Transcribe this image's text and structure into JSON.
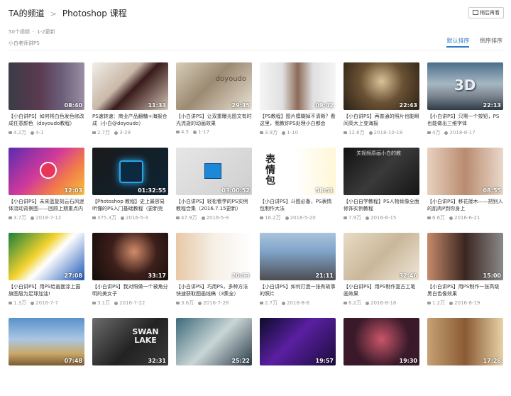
{
  "header": {
    "channel": "TA的频道",
    "sep": ">",
    "current": "Photoshop 课程",
    "later_label": "稍后再看"
  },
  "meta": {
    "count": "50个视频",
    "updated": "1-2更新",
    "dot": "·",
    "author": "小白老师讲PS"
  },
  "sort": {
    "default_label": "默认排序",
    "reverse_label": "倒序排序"
  },
  "videos": [
    {
      "title": "【小白讲PS】如何将白色发色修改成任意颜色（doyoudo教程）",
      "views": "4.2万",
      "date": "4-1",
      "duration": "08:40",
      "bg": "linear-gradient(90deg,#3b3b47,#5a3a4e 40%,#6b5e7a 70%,#9a8fa4)"
    },
    {
      "title": "PS速转速：商业产品翻糖+海报合成（小白@doyoudo）",
      "views": "2.7万",
      "date": "3-29",
      "duration": "11:33",
      "bg": "linear-gradient(135deg,#f1eee9,#c9b9a8 40%,#3a1b1b 55%,#d4c6b6)"
    },
    {
      "title": "【小白讲PS】让双重曝光图文有时光流逝的动画效果",
      "views": "4.5",
      "date": "1-17",
      "duration": "29:35",
      "bg": "linear-gradient(135deg,#d8cdb8,#9c8a72 45%,#e9e2d4)"
    },
    {
      "title": "【PS教程】图片模糊掉不清晰？看这里，我教你PS处理小白都会",
      "views": "3.9万",
      "date": "1-10",
      "duration": "09:42",
      "bg": "linear-gradient(90deg,#f5f5f5,#e0e0e0 30%,#8c6a58 50%,#e0e0e0 70%,#f5f5f5)"
    },
    {
      "title": "【小白讲PS】再普通的照片也能瞬间高大上变海报",
      "views": "12.6万",
      "date": "2018-10-18",
      "duration": "22:43",
      "bg": "radial-gradient(circle at 50% 40%,#d9c39a,#6b5234 45%,#2a2016)"
    },
    {
      "title": "【小白讲PS】只需一个按钮，PS也能做出三维字体",
      "views": "4万",
      "date": "2018-8-17",
      "duration": "22:13",
      "bg": "linear-gradient(180deg,#4b6f8a,#a6b7c3 45%,#7d8791 70%,#2f3c48)"
    },
    {
      "title": "【小白讲PS】未来蓝复刻云石风迷体流动背景图——回顾上期重点内容篇",
      "views": "3.7万",
      "date": "2018-7-12",
      "duration": "12:03",
      "bg": "linear-gradient(135deg,#5b2bb0,#d23a9a 45%,#f07a4a 70%,#f9c23d)"
    },
    {
      "title": "【Photoshop 教程】史上最容易听懂的PS入门基础教程（更新完毕）",
      "views": "375.3万",
      "date": "2016-5-3",
      "duration": "01:32:55",
      "bg": "linear-gradient(135deg,#1a1a1a,#0d2434)"
    },
    {
      "title": "【小白讲PS】轻松看学的PS实例教程合集（2016.7.15更新）",
      "views": "47.9万",
      "date": "2016-5-9",
      "duration": "03:00:52",
      "bg": "linear-gradient(135deg,#e6e6e6,#cfcfcf)"
    },
    {
      "title": "【小白讲PS】斗图必备，PS表情包制作大法",
      "views": "16.2万",
      "date": "2016-5-20",
      "duration": "58:51",
      "bg": "linear-gradient(90deg,#ffffff,#ffffff 45%,#fff7d6 100%)"
    },
    {
      "title": "【小白自学教程】PS人物肖像全面修饰实例教程",
      "views": "7.9万",
      "date": "2016-6-15",
      "duration": "",
      "bg": "linear-gradient(135deg,#111,#3a3a3a 50%,#151515)"
    },
    {
      "title": "【小白讲PS】移花接木——把别人的肌肉P到你身上",
      "views": "6.6万",
      "date": "2016-6-21",
      "duration": "08:55",
      "bg": "linear-gradient(90deg,#e7d2c0,#b98b6f 50%,#e9d9cb)"
    },
    {
      "title": "【小白讲PS】用PS给画面涂上国旗图层为足球加油!",
      "views": "1.3万",
      "date": "2016-7-7",
      "duration": "27:08",
      "bg": "linear-gradient(135deg,#1a7f3c,#f2d22e 40%,#ffffff 55%,#1a56b4)"
    },
    {
      "title": "【小白讲PS】我对照做一个被角分明的美女子",
      "views": "3.1万",
      "date": "2016-7-22",
      "duration": "33:17",
      "bg": "radial-gradient(circle at 55% 40%,#d28c6a,#3c1f1a 45%,#120c0a)"
    },
    {
      "title": "【小白讲PS】巧用PS，多种方法快速获取图画线稿（3集全）",
      "views": "3.6万",
      "date": "2016-7-28",
      "duration": "20:53",
      "bg": "linear-gradient(90deg,#e7c8a6,#f5efe6 50%,#ffffff)"
    },
    {
      "title": "【小白讲PS】如何打造一张有故事的照片",
      "views": "2.7万",
      "date": "2016-8-8",
      "duration": "21:11",
      "bg": "linear-gradient(180deg,#a9c4de,#7fa3c7 40%,#4d4d52)"
    },
    {
      "title": "【小白讲PS】用PS制作复古工笔画效果",
      "views": "6.2万",
      "date": "2016-8-18",
      "duration": "32:46",
      "bg": "linear-gradient(135deg,#e8dcc5,#c9b79a 50%,#f0e7d6)"
    },
    {
      "title": "【小白讲PS】用PS制作一张高级黑白色像效果",
      "views": "1.2万",
      "date": "2016-8-19",
      "duration": "15:00",
      "bg": "linear-gradient(90deg,#c58a6a,#3a2620 50%,#8a8a8a)"
    },
    {
      "title": "",
      "views": "",
      "date": "",
      "duration": "07:48",
      "bg": "linear-gradient(180deg,#5a91c9,#aac7e3 45%,#c9a868 75%,#7a5a33)"
    },
    {
      "title": "",
      "views": "",
      "date": "",
      "duration": "32:31",
      "bg": "linear-gradient(135deg,#6c6c6c,#222 55%,#3b3b3b)"
    },
    {
      "title": "",
      "views": "",
      "date": "",
      "duration": "25:22",
      "bg": "linear-gradient(135deg,#3d6a7a,#c9d6d6 50%,#2b3c4a)"
    },
    {
      "title": "",
      "views": "",
      "date": "",
      "duration": "19:57",
      "bg": "linear-gradient(135deg,#0c0c2a,#5a1fa2 45%,#1a0c3a)"
    },
    {
      "title": "",
      "views": "",
      "date": "",
      "duration": "19:30",
      "bg": "radial-gradient(circle at 50% 45%,#c9566a,#3a1a2a 60%)"
    },
    {
      "title": "",
      "views": "",
      "date": "",
      "duration": "17:28",
      "bg": "linear-gradient(90deg,#c6a274,#8a5a34 50%,#e8d2a8)"
    }
  ],
  "overlays": {
    "card3_text": "doyoudo",
    "card10_text": "表情包",
    "card11_text": "关视频原画小白的教",
    "card20_text": "SWAN LAKE",
    "card6_text": "3D"
  }
}
